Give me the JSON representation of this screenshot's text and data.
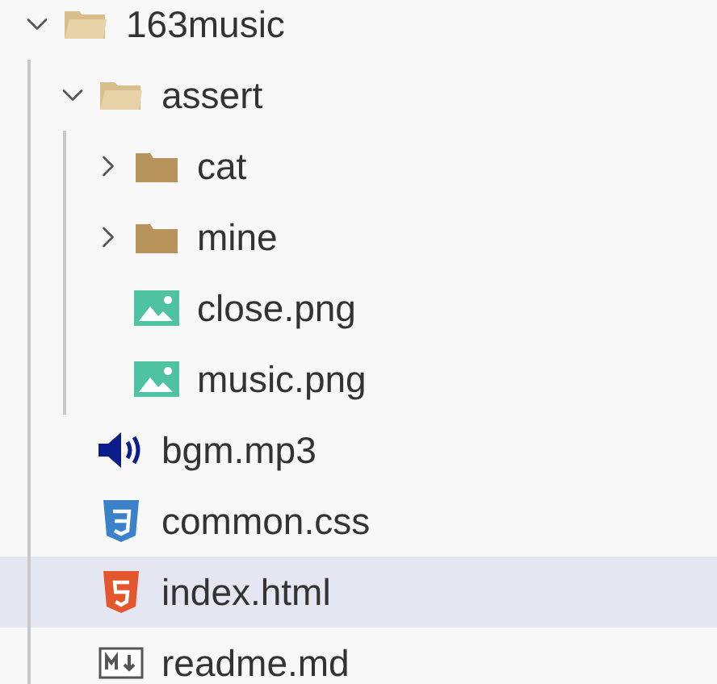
{
  "tree": [
    {
      "label": "163music",
      "kind": "folder",
      "expanded": true,
      "selected": false,
      "children": [
        {
          "label": "assert",
          "kind": "folder",
          "expanded": true,
          "selected": false,
          "children": [
            {
              "label": "cat",
              "kind": "folder",
              "expanded": false,
              "selected": false
            },
            {
              "label": "mine",
              "kind": "folder",
              "expanded": false,
              "selected": false
            },
            {
              "label": "close.png",
              "kind": "image",
              "selected": false
            },
            {
              "label": "music.png",
              "kind": "image",
              "selected": false
            }
          ]
        },
        {
          "label": "bgm.mp3",
          "kind": "audio",
          "selected": false
        },
        {
          "label": "common.css",
          "kind": "css",
          "selected": false
        },
        {
          "label": "index.html",
          "kind": "html",
          "selected": true
        },
        {
          "label": "readme.md",
          "kind": "markdown",
          "selected": false
        }
      ]
    }
  ]
}
